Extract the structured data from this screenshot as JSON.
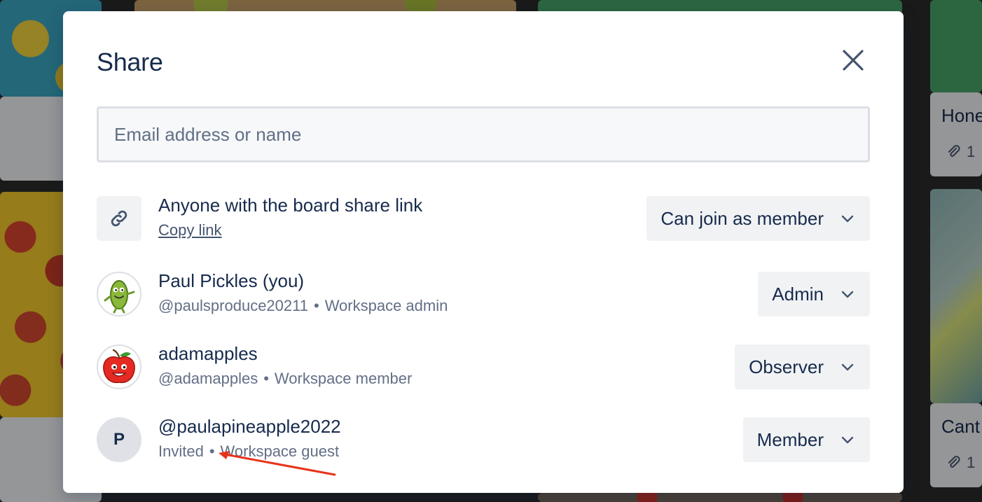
{
  "board": {
    "cards": [
      {
        "title": "Hone",
        "attachments": "1"
      },
      {
        "title": "Cant",
        "attachments": "1"
      }
    ]
  },
  "modal": {
    "title": "Share",
    "close_icon": "close-icon",
    "email_placeholder": "Email address or name",
    "share_link": {
      "icon": "link-icon",
      "label": "Anyone with the board share link",
      "copy_label": "Copy link",
      "permission": "Can join as member"
    },
    "members": [
      {
        "name": "Paul Pickles (you)",
        "username": "@paulsproduce20211",
        "role_desc": "Workspace admin",
        "role": "Admin",
        "avatar": "pickle-avatar"
      },
      {
        "name": "adamapples",
        "username": "@adamapples",
        "role_desc": "Workspace member",
        "role": "Observer",
        "avatar": "apple-avatar"
      },
      {
        "name": "@paulapineapple2022",
        "username": "Invited",
        "role_desc": "Workspace guest",
        "role": "Member",
        "initial": "P"
      }
    ]
  },
  "colors": {
    "annotation_arrow": "#e8321a",
    "text_primary": "#172b4d",
    "text_subtle": "#626f86"
  }
}
